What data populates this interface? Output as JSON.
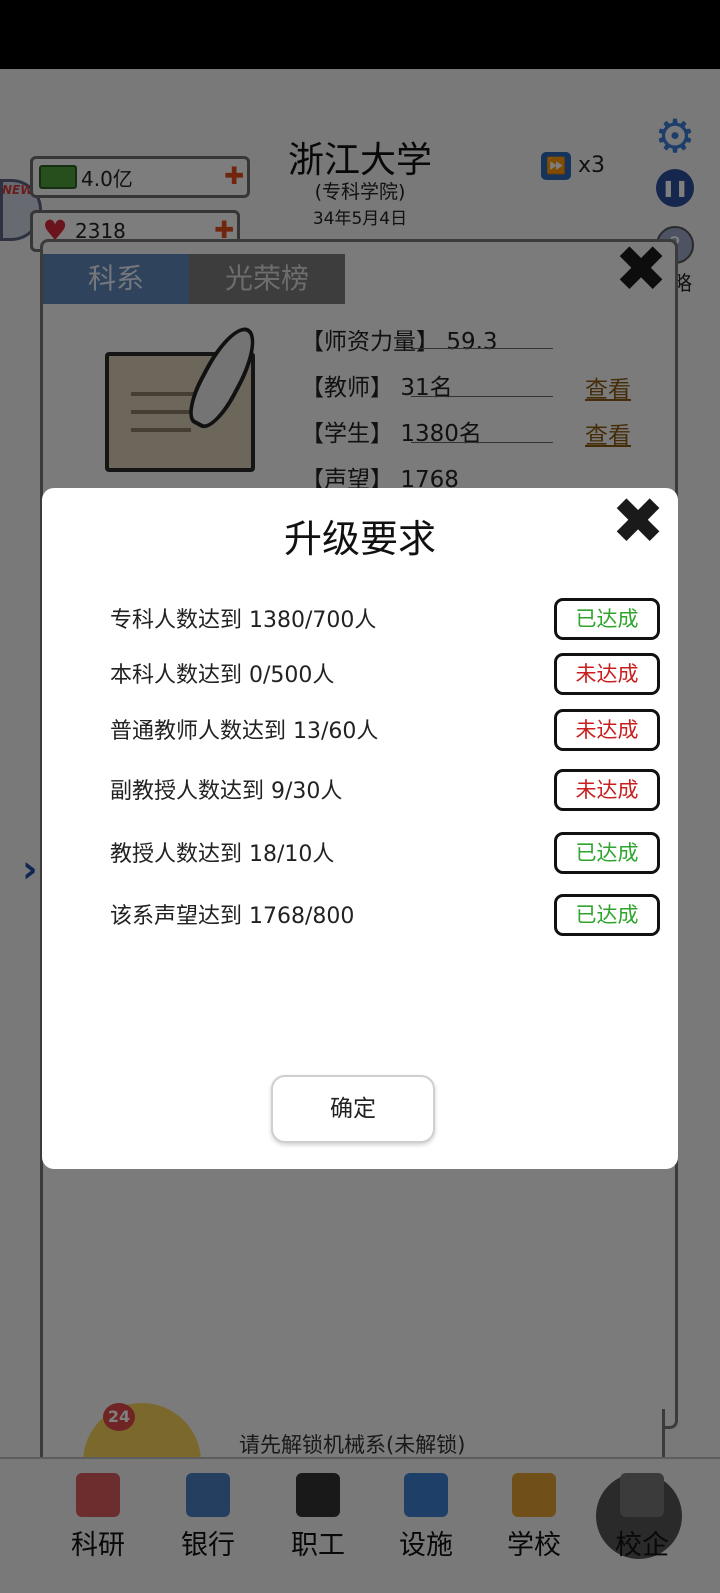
{
  "header": {
    "school_name": "浙江大学",
    "school_type": "(专科学院)",
    "date": "34年5月4日",
    "speed": "x3",
    "help_label": "略"
  },
  "resources": {
    "money": "4.0亿",
    "reputation": "2318",
    "new_badge": "NEW!"
  },
  "department_panel": {
    "tabs": [
      "科系",
      "光荣榜"
    ],
    "stats": [
      {
        "label": "【师资力量】",
        "value": "59.3",
        "link": ""
      },
      {
        "label": "【教师】",
        "value": "31名",
        "link": "查看"
      },
      {
        "label": "【学生】",
        "value": "1380名",
        "link": "查看"
      },
      {
        "label": "【声望】",
        "value": "1768",
        "link": ""
      }
    ],
    "unlock_notice": "请先解锁机械系(未解锁)",
    "avatar_badge": "24"
  },
  "nav": {
    "items": [
      {
        "label": "科研",
        "icon": "research-icon",
        "color": "#d65a5a"
      },
      {
        "label": "银行",
        "icon": "bank-icon",
        "color": "#4a7fc1"
      },
      {
        "label": "职工",
        "icon": "staff-icon",
        "color": "#333333"
      },
      {
        "label": "设施",
        "icon": "facility-icon",
        "color": "#3d7fd1"
      },
      {
        "label": "学校",
        "icon": "school-icon",
        "color": "#e0a030"
      },
      {
        "label": "校企",
        "icon": "enterprise-lock-icon",
        "color": "#555555"
      }
    ]
  },
  "modal": {
    "title": "升级要求",
    "requirements": [
      {
        "text": "专科人数达到 1380/700人",
        "status": "已达成",
        "done": true
      },
      {
        "text": "本科人数达到 0/500人",
        "status": "未达成",
        "done": false
      },
      {
        "text": "普通教师人数达到 13/60人",
        "status": "未达成",
        "done": false
      },
      {
        "text": "副教授人数达到 9/30人",
        "status": "未达成",
        "done": false
      },
      {
        "text": "教授人数达到 18/10人",
        "status": "已达成",
        "done": true
      },
      {
        "text": "该系声望达到 1768/800",
        "status": "已达成",
        "done": true
      }
    ],
    "confirm_label": "确定"
  },
  "colors": {
    "done": "#2ea52e",
    "todo": "#c81e1e",
    "tab_active": "#5e86b8",
    "overlay": "rgba(0,0,0,0.5)"
  }
}
